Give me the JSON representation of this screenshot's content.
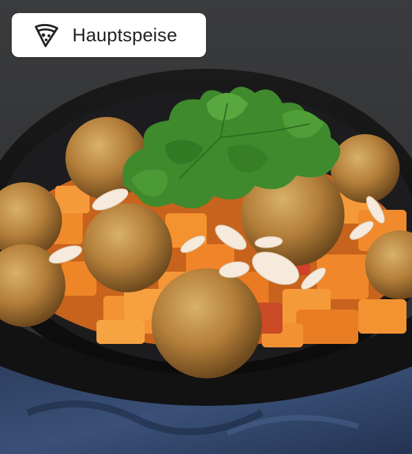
{
  "category": {
    "label": "Hauptspeise",
    "icon": "pizza-slice-icon"
  },
  "image": {
    "subject": "dish-photo"
  },
  "colors": {
    "background": "#2b2c2e",
    "pill": "#ffffff",
    "text": "#222222"
  }
}
